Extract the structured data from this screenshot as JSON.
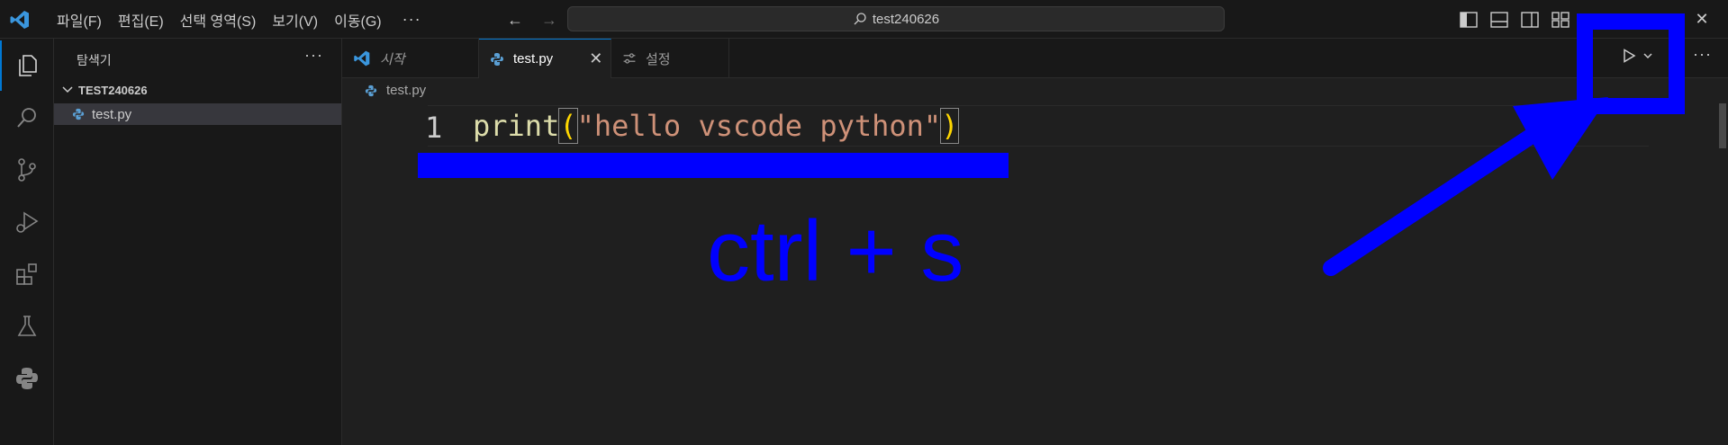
{
  "titlebar": {
    "menu": [
      "파일(F)",
      "편집(E)",
      "선택 영역(S)",
      "보기(V)",
      "이동(G)"
    ],
    "more": "···",
    "search_text": "test240626",
    "window_controls": [
      "—",
      "▢",
      "✕"
    ]
  },
  "activity_bar": {
    "items": [
      "files-icon",
      "search-icon",
      "source-control-icon",
      "run-debug-icon",
      "extensions-icon",
      "testing-icon",
      "python-icon"
    ]
  },
  "sidebar": {
    "title": "탐색기",
    "more": "···",
    "folder": "TEST240626",
    "files": [
      {
        "name": "test.py",
        "selected": true
      }
    ]
  },
  "tabs": [
    {
      "label": "시작",
      "icon": "vscode-icon",
      "italic": true,
      "active": false
    },
    {
      "label": "test.py",
      "icon": "python-icon",
      "active": true,
      "close": "✕"
    },
    {
      "label": "설정",
      "icon": "settings-icon",
      "active": false
    }
  ],
  "editor": {
    "breadcrumb": "test.py",
    "line_number": "1",
    "code": {
      "fn": "print",
      "open": "(",
      "str": "\"hello vscode python\"",
      "close": ")"
    },
    "more": "···"
  },
  "annotation": {
    "text": "ctrl + s",
    "color": "#0000ff"
  },
  "colors": {
    "accent": "#0078d4",
    "background": "#1f1f1f",
    "sidebar": "#181818"
  }
}
